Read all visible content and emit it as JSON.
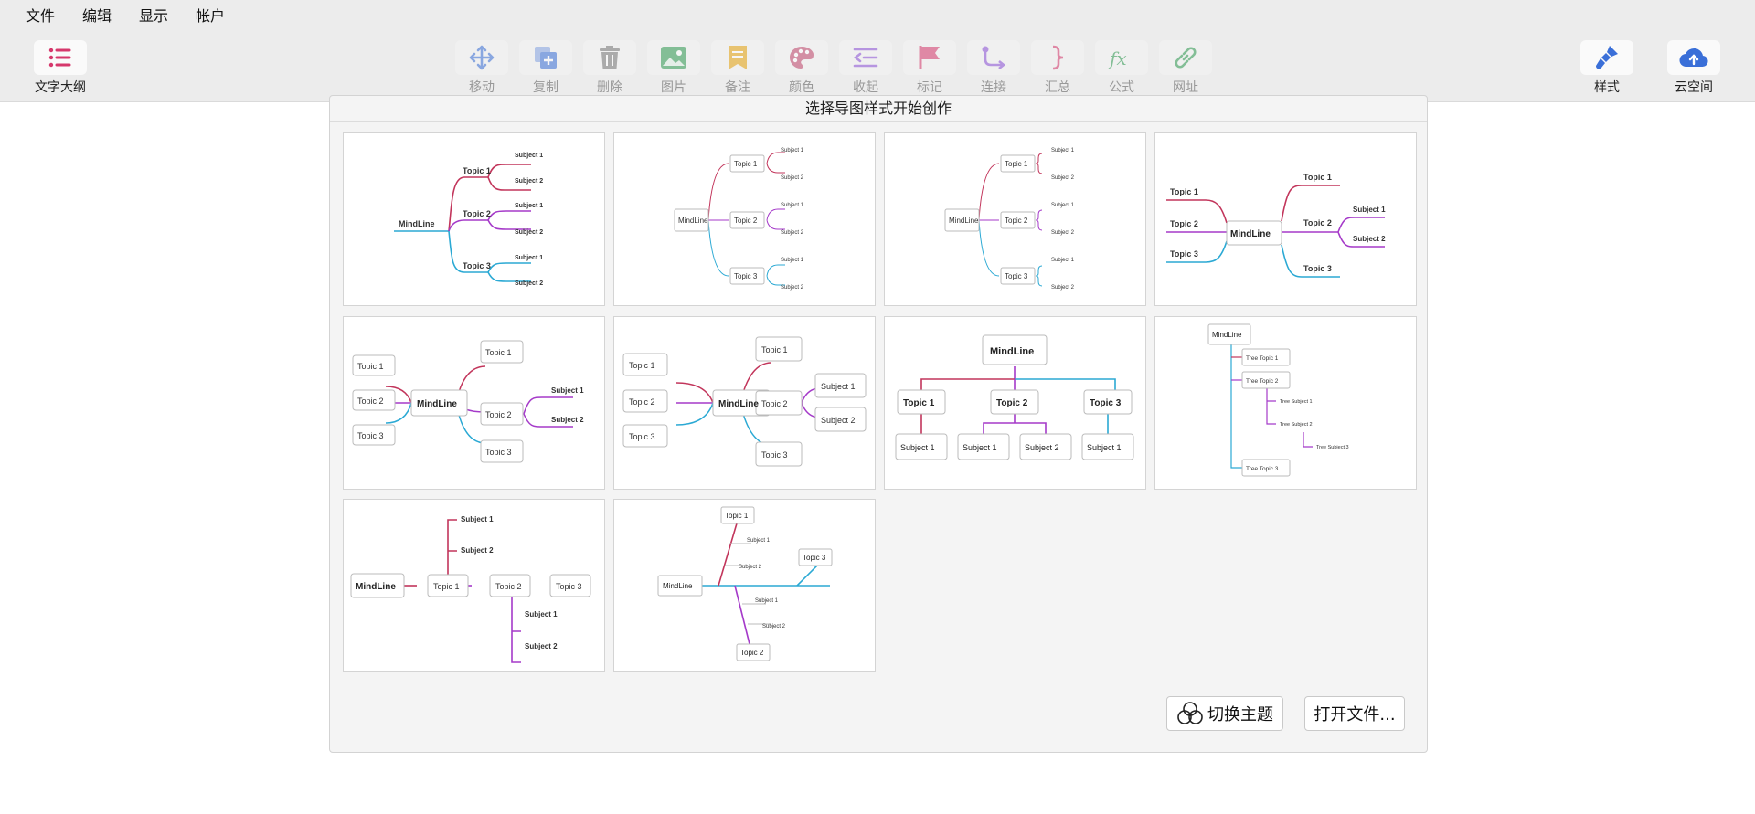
{
  "menu": [
    "文件",
    "编辑",
    "显示",
    "帐户"
  ],
  "outline": {
    "label": "文字大纲",
    "icon": "list-icon",
    "color": "#d6386c"
  },
  "tools": [
    {
      "label": "移动",
      "icon": "move-icon",
      "color": "#3a6fd8"
    },
    {
      "label": "复制",
      "icon": "copy-icon",
      "color": "#3a6fd8"
    },
    {
      "label": "删除",
      "icon": "trash-icon",
      "color": "#777777"
    },
    {
      "label": "图片",
      "icon": "image-icon",
      "color": "#2e9a50"
    },
    {
      "label": "备注",
      "icon": "note-icon",
      "color": "#e5a20b"
    },
    {
      "label": "颜色",
      "icon": "palette-icon",
      "color": "#c0446a"
    },
    {
      "label": "收起",
      "icon": "collapse-icon",
      "color": "#8a4fd8"
    },
    {
      "label": "标记",
      "icon": "flag-icon",
      "color": "#d6386c"
    },
    {
      "label": "连接",
      "icon": "connect-icon",
      "color": "#8a4fd8"
    },
    {
      "label": "汇总",
      "icon": "brace-icon",
      "color": "#d6386c"
    },
    {
      "label": "公式",
      "icon": "formula-icon",
      "color": "#2e9a50"
    },
    {
      "label": "网址",
      "icon": "link-icon",
      "color": "#2e9a50"
    }
  ],
  "style": {
    "label": "样式",
    "icon": "brush-icon",
    "color": "#3a6fd8"
  },
  "cloud": {
    "label": "云空间",
    "icon": "cloud-upload-icon",
    "color": "#3a6fd8"
  },
  "dialog": {
    "title": "选择导图样式开始创作",
    "switch_theme": "切换主题",
    "open_file": "打开文件..."
  },
  "colors": {
    "red": "#c2355b",
    "purple": "#a53ac9",
    "blue": "#2ba9d4"
  },
  "templates": {
    "root": "MindLine",
    "topic1": "Topic 1",
    "topic2": "Topic 2",
    "topic3": "Topic 3",
    "subject1": "Subject 1",
    "subject2": "Subject 2",
    "tree_topic1": "Tree Topic 1",
    "tree_topic2": "Tree Topic 2",
    "tree_topic3": "Tree Topic 3",
    "tree_subject1": "Tree Subject 1",
    "tree_subject2": "Tree Subject 2",
    "tree_subject3": "Tree Subject 3"
  }
}
